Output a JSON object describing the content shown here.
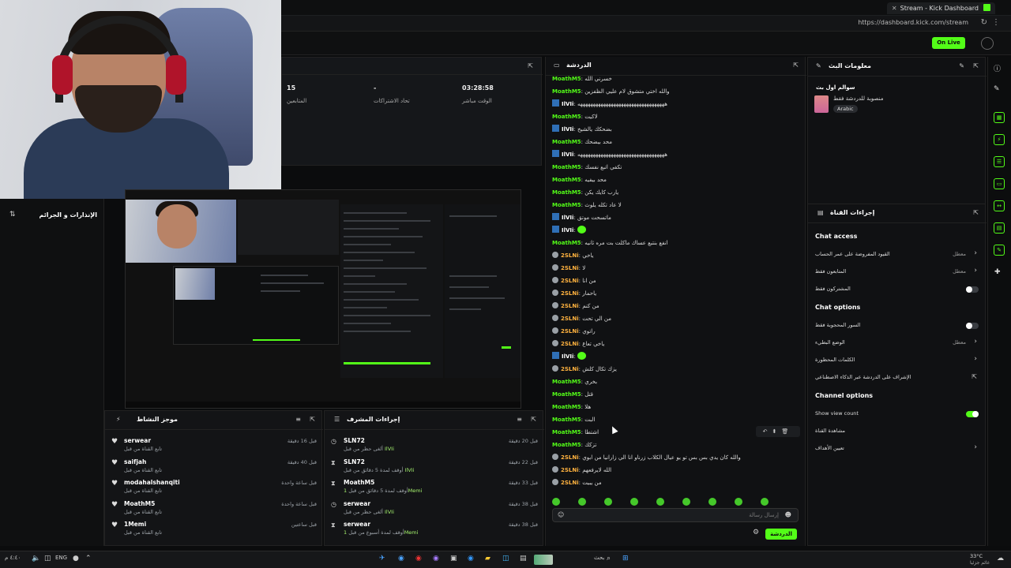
{
  "browser": {
    "tab_title": "Stream - Kick Dashboard",
    "url": "https://dashboard.kick.com/stream",
    "go_live_label": "On Live"
  },
  "left_panel": {
    "title": "الإنذارات و الجرائم"
  },
  "stats": [
    {
      "value": "15",
      "label": "المتابعين"
    },
    {
      "value": "-",
      "label": "تحاد الاشتراكات"
    },
    {
      "value": "03:28:58",
      "label": "الوقت مباشر"
    }
  ],
  "activity": {
    "title": "موجز النشاط",
    "rows": [
      {
        "name": "serwear",
        "sub": "تابع القناة من قبل",
        "time": "قبل 16 دقيقة"
      },
      {
        "name": "saifjah",
        "sub": "تابع القناة من قبل",
        "time": "قبل 40 دقيقة"
      },
      {
        "name": "modahalshanqiti",
        "sub": "تابع القناة من قبل",
        "time": "قبل ساعة واحدة"
      },
      {
        "name": "MoathM5",
        "sub": "تابع القناة من قبل",
        "time": "قبل ساعة واحدة"
      },
      {
        "name": "1Memi",
        "sub": "تابع القناة من قبل",
        "time": "قبل ساعتين"
      }
    ]
  },
  "mod_actions": {
    "title": "إجراءات المشرف",
    "rows": [
      {
        "icon": "clock",
        "name": "SLN72",
        "sub": "ألغى حظر من قبل",
        "target": "IlVIi",
        "time": "قبل 20 دقيقة"
      },
      {
        "icon": "hourglass",
        "name": "SLN72",
        "sub": "أوقف لمدة 5 دقائق من قبل",
        "target": "IlVIi",
        "time": "قبل 22 دقيقة"
      },
      {
        "icon": "hourglass",
        "name": "MoathM5",
        "sub": "أوقف لمدة 5 دقائق من قبل",
        "target": "1Memi",
        "time": "قبل 33 دقيقة"
      },
      {
        "icon": "clock",
        "name": "serwear",
        "sub": "ألغى حظر من قبل",
        "target": "IlVIi",
        "time": "قبل 38 دقيقة"
      },
      {
        "icon": "hourglass",
        "name": "serwear",
        "sub": "أوقف لمدة أسبوع من قبل",
        "target": "1Memi",
        "time": "قبل 38 دقيقة"
      }
    ]
  },
  "chat": {
    "title": "الدردشة",
    "send_label": "الدردشة",
    "input_placeholder": "إرسال رسالة",
    "messages": [
      {
        "user": "MoathM5",
        "color": "green",
        "badge": "",
        "text": "خسرني الله"
      },
      {
        "user": "MoathM5",
        "color": "green",
        "badge": "",
        "text": "والله اختي متشوق لام عليي الظفزين"
      },
      {
        "user": "IlVIi",
        "color": "white",
        "badge": "blue",
        "text": "ههههههههههههههههههههههههههههههههههه"
      },
      {
        "user": "MoathM5",
        "color": "green",
        "badge": "",
        "text": "لاكيت"
      },
      {
        "user": "IlVIi",
        "color": "white",
        "badge": "blue",
        "text": "بضحكك يالشيخ"
      },
      {
        "user": "MoathM5",
        "color": "green",
        "badge": "",
        "text": "محد بيضحك"
      },
      {
        "user": "IlVIi",
        "color": "white",
        "badge": "blue",
        "text": "ههههههههههههههههههههههههههههههههههه"
      },
      {
        "user": "MoathM5",
        "color": "green",
        "badge": "",
        "text": "تكفي اتبع نفسك"
      },
      {
        "user": "MoathM5",
        "color": "green",
        "badge": "",
        "text": "محد بيفيه"
      },
      {
        "user": "MoathM5",
        "color": "green",
        "badge": "",
        "text": "يارب كايك يكن"
      },
      {
        "user": "MoathM5",
        "color": "green",
        "badge": "",
        "text": "لا عاد تكله يلوث"
      },
      {
        "user": "IlVIi",
        "color": "white",
        "badge": "blue",
        "text": "ماتسحت موتق"
      },
      {
        "user": "IlVIi",
        "color": "white",
        "badge": "blue",
        "text": "",
        "emote": true
      },
      {
        "user": "MoathM5",
        "color": "green",
        "badge": "",
        "text": "انفع بنتبع عساك ماكلت بت مره ثانيه"
      },
      {
        "user": "2SLNi",
        "color": "orange",
        "badge": "circle",
        "text": "ياخي"
      },
      {
        "user": "2SLNi",
        "color": "orange",
        "badge": "circle",
        "text": "لا"
      },
      {
        "user": "2SLNi",
        "color": "orange",
        "badge": "circle",
        "text": "من انا"
      },
      {
        "user": "2SLNi",
        "color": "orange",
        "badge": "circle",
        "text": "ياحمار"
      },
      {
        "user": "2SLNi",
        "color": "orange",
        "badge": "circle",
        "text": "من كنم"
      },
      {
        "user": "2SLNi",
        "color": "orange",
        "badge": "circle",
        "text": "من الي تحت"
      },
      {
        "user": "2SLNi",
        "color": "orange",
        "badge": "circle",
        "text": "راتوي"
      },
      {
        "user": "2SLNi",
        "color": "orange",
        "badge": "circle",
        "text": "ياخي تعاع"
      },
      {
        "user": "IlVIi",
        "color": "white",
        "badge": "blue",
        "text": "",
        "emote": true
      },
      {
        "user": "2SLNi",
        "color": "orange",
        "badge": "circle",
        "text": "يزك تكال كلش"
      },
      {
        "user": "MoathM5",
        "color": "green",
        "badge": "",
        "text": "بخري"
      },
      {
        "user": "MoathM5",
        "color": "green",
        "badge": "",
        "text": "قتل"
      },
      {
        "user": "MoathM5",
        "color": "green",
        "badge": "",
        "text": "هلا"
      },
      {
        "user": "MoathM5",
        "color": "green",
        "badge": "",
        "text": "البت"
      },
      {
        "user": "MoathM5",
        "color": "green",
        "badge": "",
        "text": "اشتطا"
      },
      {
        "user": "MoathM5",
        "color": "green",
        "badge": "",
        "text": "تزكك"
      },
      {
        "user": "2SLNi",
        "color": "orange",
        "badge": "circle",
        "text": "والله كان يدي بس بس تو يو عيال الكلاب زرناو انا الي زارانيا من ابوي"
      },
      {
        "user": "2SLNi",
        "color": "orange",
        "badge": "circle",
        "text": "الله لايرفعهم"
      },
      {
        "user": "2SLNi",
        "color": "orange",
        "badge": "circle",
        "text": "من يبيت"
      }
    ]
  },
  "stream_info": {
    "title": "معلومات البث",
    "stream_title": "سوالم اول بث",
    "category": "منصوبة للدردشة فقط",
    "language": "Arabic"
  },
  "channel_actions": {
    "title": "إجراءات القناة",
    "chat_access": {
      "heading": "Chat access",
      "items": [
        {
          "label": "القيود المفروضة على عمر الحساب",
          "value": "معطل",
          "kind": "chevron"
        },
        {
          "label": "المتابعون فقط",
          "value": "معطل",
          "kind": "chevron"
        },
        {
          "label": "المشتركون فقط",
          "value": "",
          "kind": "toggle",
          "on": false
        }
      ]
    },
    "chat_options": {
      "heading": "Chat options",
      "items": [
        {
          "label": "السور المحجوبة فقط",
          "value": "",
          "kind": "toggle",
          "on": false
        },
        {
          "label": "الوضع البطيء",
          "value": "معطل",
          "kind": "chevron"
        },
        {
          "label": "الكلمات المحظورة",
          "value": "",
          "kind": "chevron"
        },
        {
          "label": "الإشراف على الدردشة عبر الذكاء الاصطناعي",
          "value": "",
          "kind": "external"
        }
      ]
    },
    "channel_options": {
      "heading": "Channel options",
      "items": [
        {
          "label": "Show view count",
          "value": "",
          "kind": "toggle",
          "on": true,
          "ltr": true
        },
        {
          "label": "مشاهدة القناة",
          "value": "",
          "kind": "none"
        },
        {
          "label": "تعيين الأهداف",
          "value": "",
          "kind": "chevron"
        }
      ]
    }
  },
  "taskbar": {
    "time": "٤:٤٠ م",
    "date": "٢٠٢٥/٥/١٢",
    "lang": "ENG",
    "weather": "33°C",
    "weather_text": "غائم جزئيا",
    "search": "بحث"
  },
  "colors": {
    "kick_green": "#53fc18",
    "panel_bg": "#101113"
  }
}
